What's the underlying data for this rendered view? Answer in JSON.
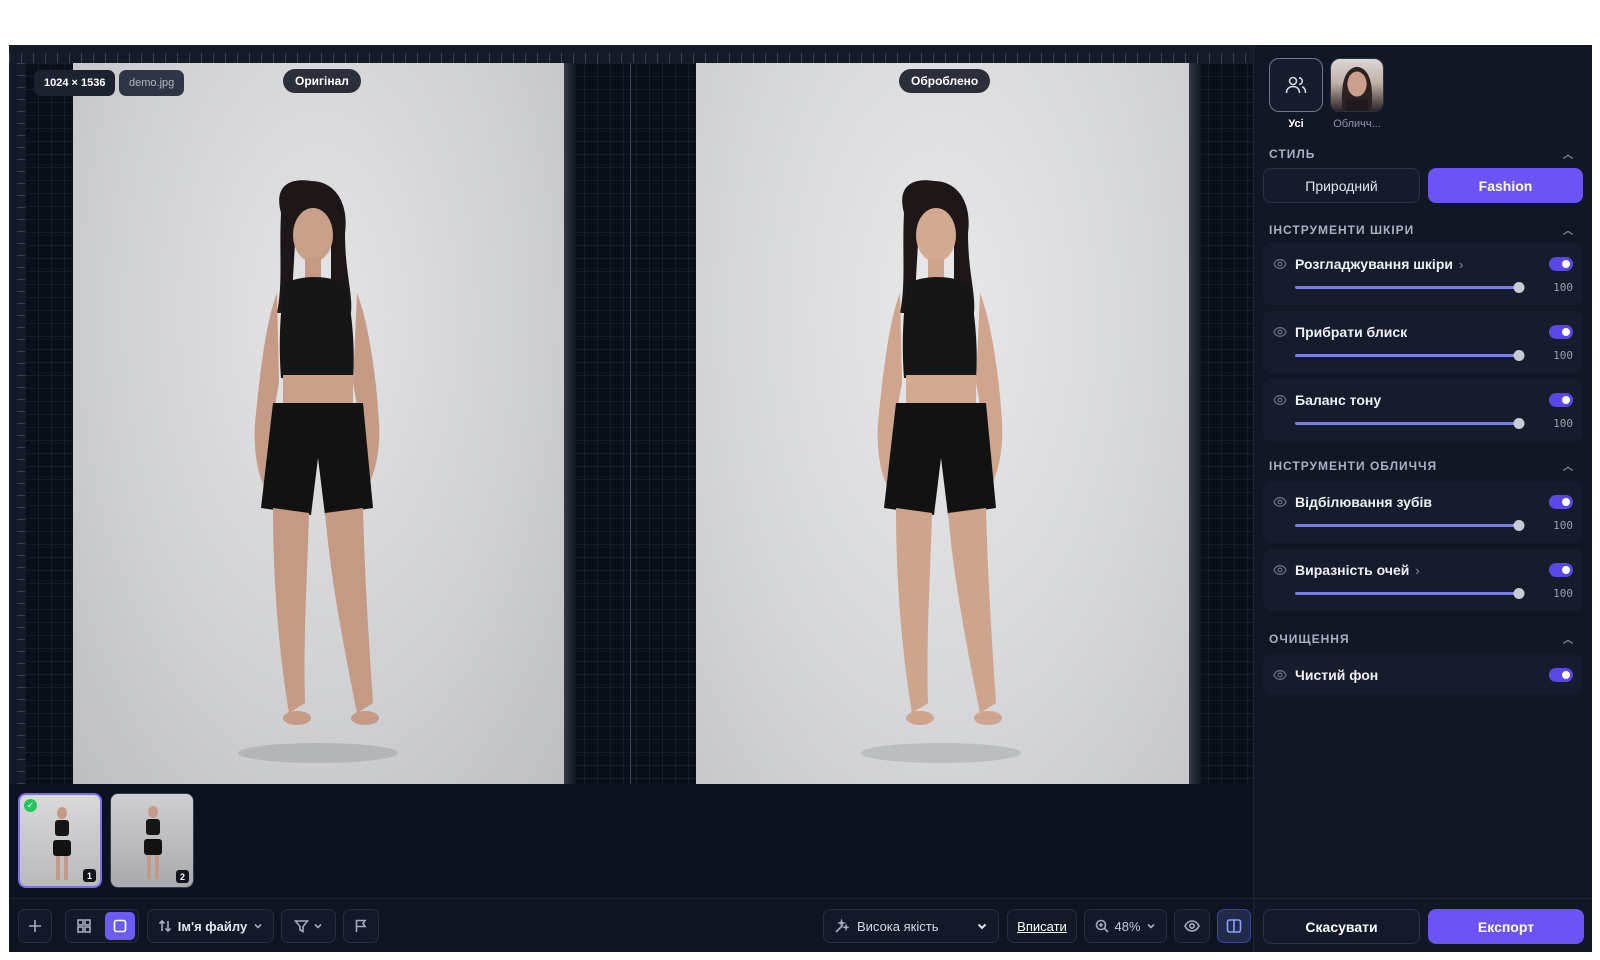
{
  "canvas": {
    "image_size": "1024 × 1536",
    "file_name": "demo.jpg",
    "original_label": "Оригінал",
    "processed_label": "Оброблено"
  },
  "filmstrip": {
    "thumbs": [
      {
        "number": "1",
        "selected": true,
        "processed": true
      },
      {
        "number": "2",
        "selected": false,
        "processed": false
      }
    ]
  },
  "toolbar": {
    "add_icon": "plus-icon",
    "view_modes": [
      "grid",
      "single"
    ],
    "sort_label": "Ім'я файлу",
    "quality_label": "Висока якість",
    "fit_label": "Вписати",
    "zoom_label": "48%"
  },
  "panel": {
    "faces": [
      {
        "label": "Усі",
        "icon": "users-icon",
        "selected": true
      },
      {
        "label": "Обличч...",
        "selected": false
      }
    ],
    "sections": {
      "style": {
        "title": "СТИЛЬ",
        "options": [
          "Природний",
          "Fashion"
        ],
        "selected": "Fashion"
      },
      "skin": {
        "title": "ІНСТРУМЕНТИ ШКІРИ",
        "tools": [
          {
            "name": "Розгладжування шкіри",
            "has_submenu": true,
            "enabled": true,
            "value": "100"
          },
          {
            "name": "Прибрати блиск",
            "has_submenu": false,
            "enabled": true,
            "value": "100"
          },
          {
            "name": "Баланс тону",
            "has_submenu": false,
            "enabled": true,
            "value": "100"
          }
        ]
      },
      "face": {
        "title": "ІНСТРУМЕНТИ ОБЛИЧЧЯ",
        "tools": [
          {
            "name": "Відбілювання зубів",
            "has_submenu": false,
            "enabled": true,
            "value": "100"
          },
          {
            "name": "Виразність очей",
            "has_submenu": true,
            "enabled": true,
            "value": "100"
          }
        ]
      },
      "cleanup": {
        "title": "ОЧИЩЕННЯ",
        "tools": [
          {
            "name": "Чистий фон",
            "enabled": true
          }
        ]
      }
    },
    "footer": {
      "cancel_label": "Скасувати",
      "export_label": "Експорт"
    }
  },
  "colors": {
    "accent": "#6c53f5",
    "background": "#0f1421",
    "panel": "#121726"
  }
}
